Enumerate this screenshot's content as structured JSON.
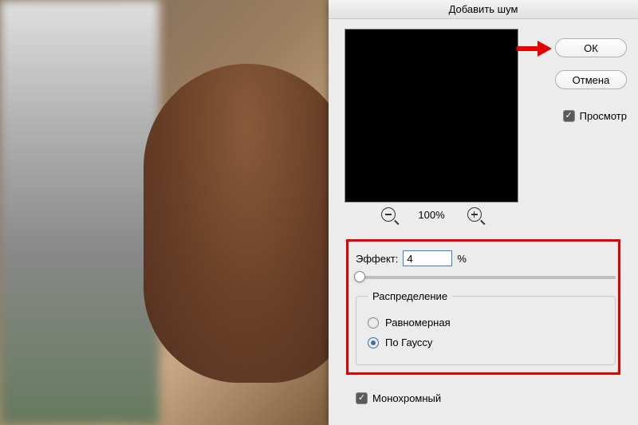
{
  "dialog": {
    "title": "Добавить шум",
    "ok_label": "ОК",
    "cancel_label": "Отмена",
    "preview_label": "Просмотр",
    "preview_checked": true,
    "zoom_level": "100%"
  },
  "effect": {
    "label": "Эффект:",
    "value": "4",
    "unit": "%"
  },
  "distribution": {
    "group_label": "Распределение",
    "options": [
      {
        "label": "Равномерная",
        "selected": false
      },
      {
        "label": "По Гауссу",
        "selected": true
      }
    ]
  },
  "monochrome": {
    "label": "Монохромный",
    "checked": true
  },
  "icons": {
    "checkmark": "✓"
  }
}
